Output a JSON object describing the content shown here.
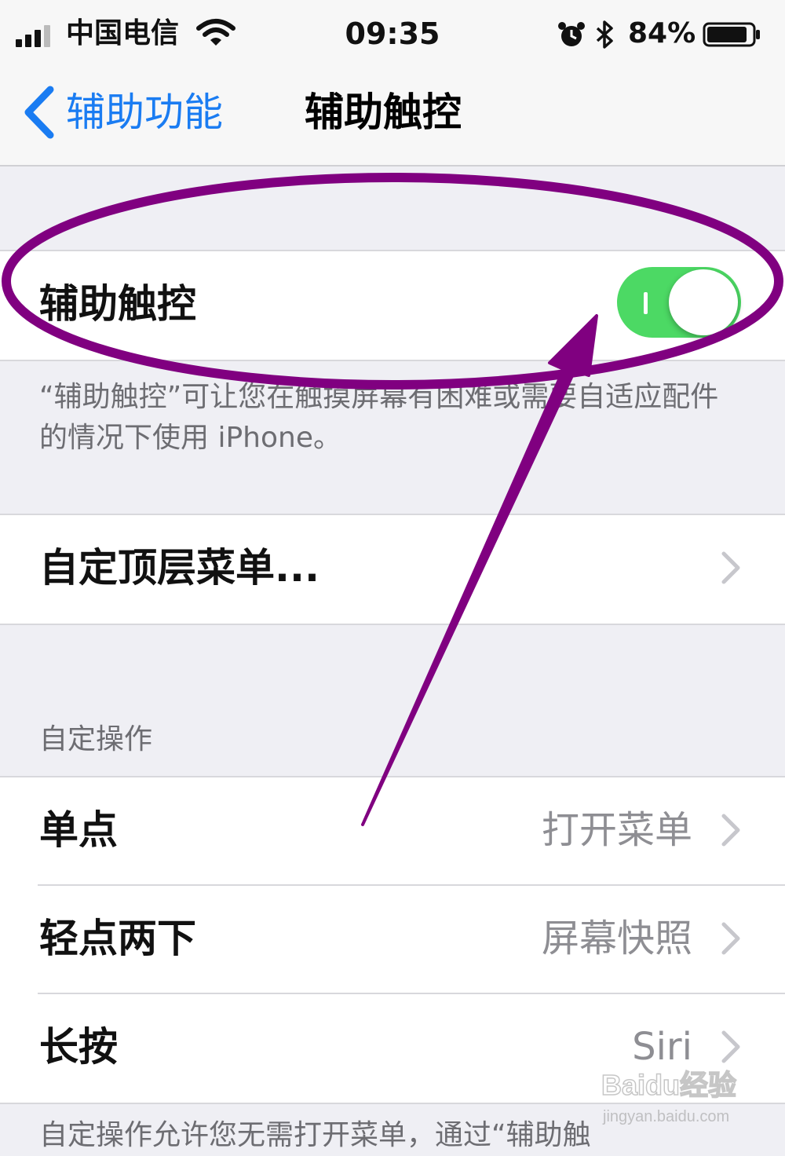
{
  "status_bar": {
    "carrier": "中国电信",
    "time": "09:35",
    "battery": "84%"
  },
  "nav": {
    "back_label": "辅助功能",
    "title": "辅助触控"
  },
  "assistive_touch": {
    "label": "辅助触控",
    "enabled": true,
    "footer": "“辅助触控”可让您在触摸屏幕有困难或需要自适应配件的情况下使用 iPhone。"
  },
  "customize_menu": {
    "label": "自定顶层菜单..."
  },
  "custom_actions": {
    "header": "自定操作",
    "rows": [
      {
        "label": "单点",
        "value": "打开菜单"
      },
      {
        "label": "轻点两下",
        "value": "屏幕快照"
      },
      {
        "label": "长按",
        "value": "Siri"
      }
    ],
    "footer": "自定操作允许您无需打开菜单，通过“辅助触"
  },
  "watermark": {
    "brand": "Baidu经验",
    "url": "jingyan.baidu.com"
  },
  "colors": {
    "accent": "#1a7cf2",
    "toggle_on": "#4cd964",
    "annotation": "#800080"
  }
}
